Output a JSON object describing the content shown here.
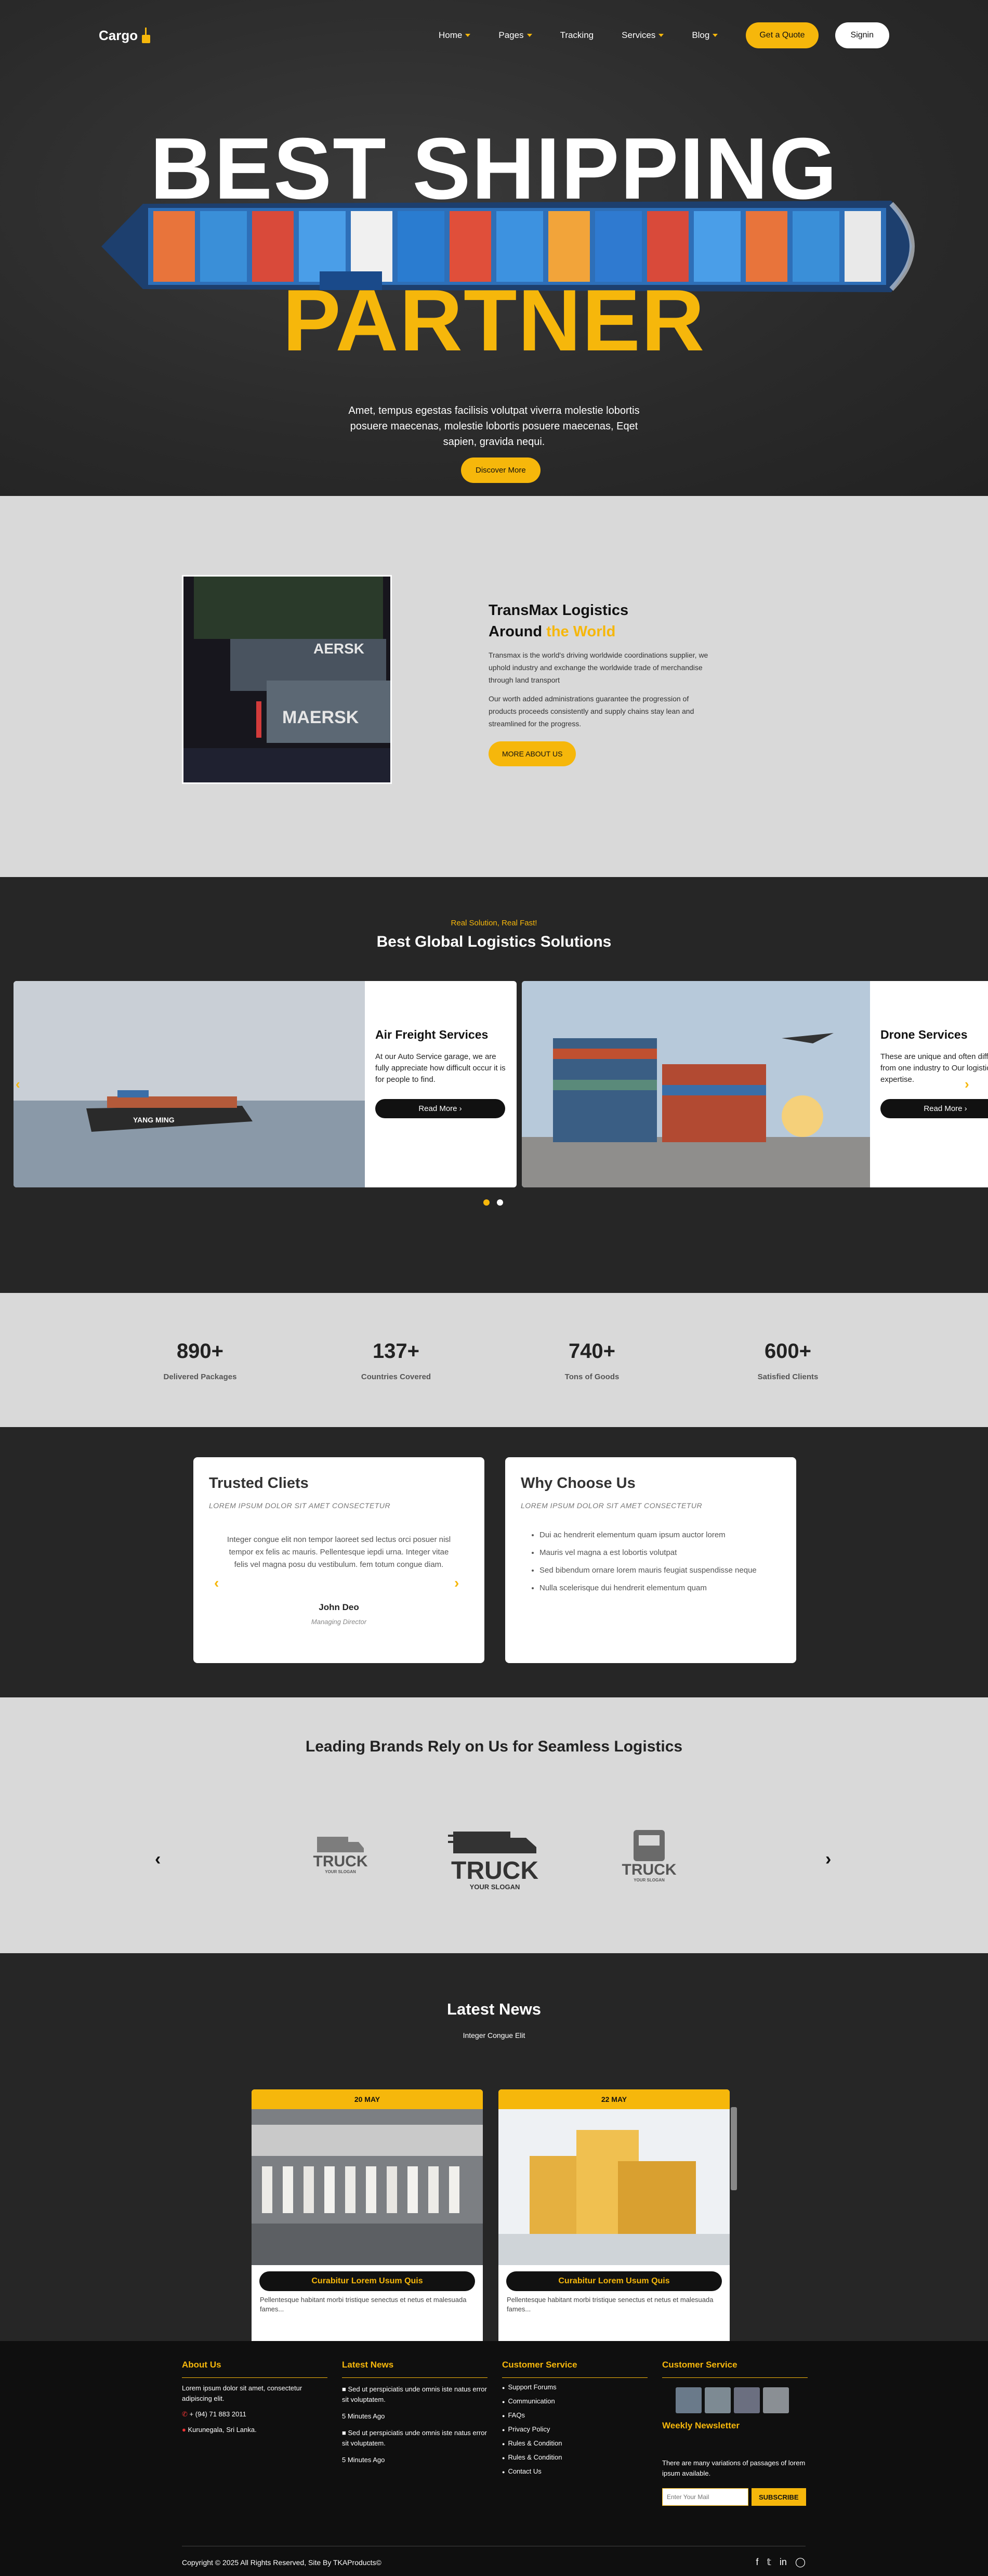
{
  "header": {
    "logo": "Cargo",
    "nav": [
      {
        "label": "Home",
        "dropdown": true
      },
      {
        "label": "Pages",
        "dropdown": true
      },
      {
        "label": "Tracking",
        "dropdown": false
      },
      {
        "label": "Services",
        "dropdown": true
      },
      {
        "label": "Blog",
        "dropdown": true
      }
    ],
    "quote_button": "Get a Quote",
    "signin_button": "Signin"
  },
  "hero": {
    "line1": "BEST SHIPPING",
    "line2": "PARTNER",
    "description": "Amet, tempus egestas facilisis volutpat viverra molestie lobortis posuere maecenas, molestie lobortis posuere maecenas, Eqet sapien, gravida nequi.",
    "cta": "Discover More"
  },
  "about": {
    "title_a": "TransMax Logistics",
    "title_b": "Around",
    "title_hl": "the World",
    "para1": "Transmax is the world's driving worldwide coordinations supplier, we uphold industry and exchange the worldwide trade of merchandise through land transport",
    "para2": "Our worth added administrations guarantee the progression of products proceeds consistently and supply chains stay lean and streamlined for the progress.",
    "cta": "MORE ABOUT US",
    "image_text": [
      "AERSK",
      "MAERSK"
    ]
  },
  "solutions": {
    "kicker": "Real Solution, Real Fast!",
    "title": "Best Global Logistics Solutions",
    "cards": [
      {
        "title": "Air Freight Services",
        "text": "At our Auto Service garage, we are fully appreciate how difficult occur it is for people to find.",
        "button": "Read More",
        "image_text": "YANG MING"
      },
      {
        "title": "Drone Services",
        "text": "These are unique and often differ from one industry to Our logistics expertise.",
        "button": "Read More"
      }
    ]
  },
  "stats": [
    {
      "value": "890+",
      "label": "Delivered Packages"
    },
    {
      "value": "137+",
      "label": "Countries Covered"
    },
    {
      "value": "740+",
      "label": "Tons of Goods"
    },
    {
      "value": "600+",
      "label": "Satisfied Clients"
    }
  ],
  "testimonials": {
    "title": "Trusted Cliets",
    "subtitle": "LOREM IPSUM DOLOR SIT AMET CONSECTETUR",
    "quote": "Integer congue elit non tempor laoreet sed lectus orci posuer nisl tempor ex felis ac mauris. Pellentesque iepdi urna. Integer vitae felis vel magna posu du vestibulum. fem totum congue diam.",
    "name": "John Deo",
    "role": "Managing Director"
  },
  "why": {
    "title": "Why Choose Us",
    "subtitle": "LOREM IPSUM DOLOR SIT AMET CONSECTETUR",
    "items": [
      "Dui ac hendrerit elementum quam ipsum auctor lorem",
      "Mauris vel magna a est lobortis volutpat",
      "Sed bibendum ornare lorem mauris feugiat suspendisse neque",
      "Nulla scelerisque dui hendrerit elementum quam"
    ]
  },
  "brands": {
    "title": "Leading Brands Rely on Us for Seamless Logistics",
    "logos": [
      {
        "name": "TRUCK",
        "slogan": "YOUR SLOGAN"
      },
      {
        "name": "TRUCK",
        "slogan": "YOUR SLOGAN"
      },
      {
        "name": "TRUCK",
        "slogan": "YOUR SLOGAN"
      }
    ]
  },
  "news": {
    "title": "Latest News",
    "subtitle": "Integer Congue Elit",
    "items": [
      {
        "date": "20 MAY",
        "title": "Curabitur Lorem Usum Quis",
        "text": "Pellentesque habitant morbi tristique senectus et netus et malesuada fames..."
      },
      {
        "date": "22 MAY",
        "title": "Curabitur Lorem Usum Quis",
        "text": "Pellentesque habitant morbi tristique senectus et netus et malesuada fames..."
      }
    ]
  },
  "footer": {
    "about": {
      "title": "About Us",
      "text": "Lorem ipsum dolor sit amet, consectetur adipiscing elit.",
      "phone": "+ (94) 71 883 2011",
      "address": "Kurunegala, Sri Lanka."
    },
    "latest": {
      "title": "Latest News",
      "items": [
        {
          "text": "Sed ut perspiciatis unde omnis iste natus error sit voluptatem.",
          "time": "5 Minutes Ago"
        },
        {
          "text": "Sed ut perspiciatis unde omnis iste natus error sit voluptatem.",
          "time": "5 Minutes Ago"
        }
      ]
    },
    "service": {
      "title": "Customer Service",
      "links": [
        "Support Forums",
        "Communication",
        "FAQs",
        "Privacy Policy",
        "Rules & Condition",
        "Rules & Condition",
        "Contact Us"
      ]
    },
    "service2": {
      "title": "Customer Service",
      "newsletter_title": "Weekly Newsletter",
      "newsletter_text": "There are many variations of passages of lorem ipsum available.",
      "input_placeholder": "Enter Your Mail",
      "subscribe": "SUBSCRIBE"
    },
    "copyright": "Copyright © 2025 All Rights Reserved, Site By TKAProducts©",
    "social_icons": [
      "facebook-icon",
      "twitter-icon",
      "linkedin-icon",
      "instagram-icon"
    ]
  },
  "colors": {
    "accent": "#f6b70b",
    "dark": "#262626",
    "light": "#d9d9d9"
  }
}
